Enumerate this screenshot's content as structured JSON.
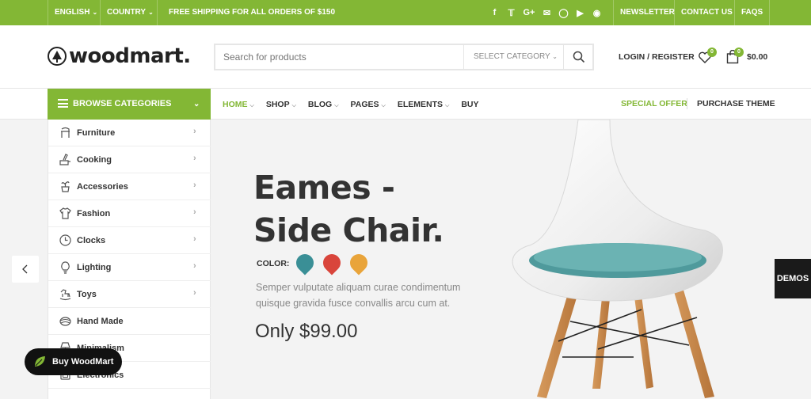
{
  "topbar": {
    "language": "ENGLISH",
    "country": "COUNTRY",
    "shipping": "FREE SHIPPING FOR ALL ORDERS OF $150",
    "socials": [
      "facebook-icon",
      "twitter-icon",
      "google-plus-icon",
      "email-icon",
      "instagram-icon",
      "youtube-icon",
      "pinterest-icon"
    ],
    "links": [
      "NEWSLETTER",
      "CONTACT US",
      "FAQS"
    ]
  },
  "header": {
    "logo": "woodmart.",
    "search_placeholder": "Search for products",
    "category_select": "SELECT CATEGORY",
    "login": "LOGIN / REGISTER",
    "wishlist_count": "0",
    "cart_count": "0",
    "cart_total": "$0.00"
  },
  "nav": {
    "browse": "BROWSE CATEGORIES",
    "items": [
      {
        "label": "HOME",
        "active": true,
        "caret": true
      },
      {
        "label": "SHOP",
        "active": false,
        "caret": true
      },
      {
        "label": "BLOG",
        "active": false,
        "caret": true
      },
      {
        "label": "PAGES",
        "active": false,
        "caret": true
      },
      {
        "label": "ELEMENTS",
        "active": false,
        "caret": true
      },
      {
        "label": "BUY",
        "active": false,
        "caret": false
      }
    ],
    "special_offer": "SPECIAL OFFER",
    "purchase_theme": "PURCHASE THEME"
  },
  "categories": [
    {
      "label": "Furniture",
      "icon": "chair-icon",
      "arrow": true
    },
    {
      "label": "Cooking",
      "icon": "cooking-icon",
      "arrow": true
    },
    {
      "label": "Accessories",
      "icon": "plant-icon",
      "arrow": true
    },
    {
      "label": "Fashion",
      "icon": "shirt-icon",
      "arrow": true
    },
    {
      "label": "Clocks",
      "icon": "clock-icon",
      "arrow": true
    },
    {
      "label": "Lighting",
      "icon": "bulb-icon",
      "arrow": true
    },
    {
      "label": "Toys",
      "icon": "horse-icon",
      "arrow": true
    },
    {
      "label": "Hand Made",
      "icon": "yarn-icon",
      "arrow": false
    },
    {
      "label": "Minimalism",
      "icon": "lamp-icon",
      "arrow": false
    },
    {
      "label": "Electronics",
      "icon": "device-icon",
      "arrow": false
    }
  ],
  "hero": {
    "title_line1": "Eames -",
    "title_line2": "Side Chair.",
    "color_label": "COLOR:",
    "colors": [
      "#3a8f96",
      "#d9453b",
      "#e9a43a"
    ],
    "description": "Semper vulputate aliquam curae condimentum quisque gravida fusce convallis arcu cum at.",
    "price": "Only $99.00"
  },
  "demos": "DEMOS",
  "buy_button": "Buy WoodMart",
  "colors": {
    "accent": "#83b735",
    "dark": "#111111"
  }
}
